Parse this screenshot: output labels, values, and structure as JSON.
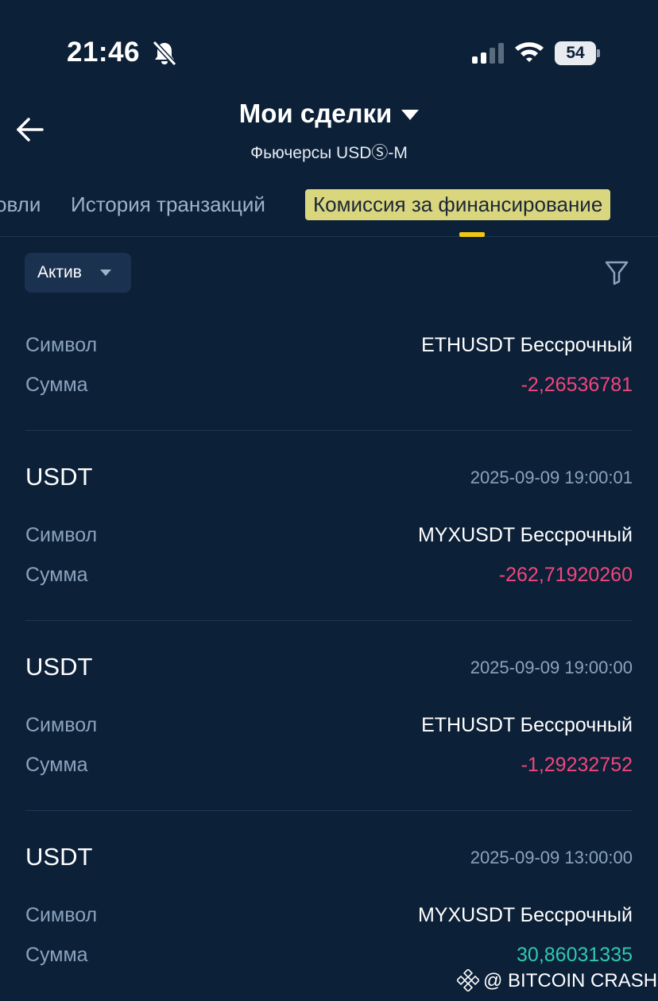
{
  "status_bar": {
    "time": "21:46",
    "battery": "54",
    "icons": [
      "bell-slash-icon",
      "signal-icon",
      "wifi-icon",
      "battery-icon"
    ]
  },
  "header": {
    "title": "Мои сделки",
    "subtitle": "Фьючерсы USDⓈ-M",
    "back_icon": "arrow-left-icon",
    "dropdown_icon": "caret-down-icon"
  },
  "tabs": [
    {
      "label": "овли",
      "active": false
    },
    {
      "label": "История транзакций",
      "active": false
    },
    {
      "label": "Комиссия за финансирование",
      "active": true
    }
  ],
  "filters": {
    "asset_label": "Актив",
    "filter_icon": "funnel-icon"
  },
  "records": [
    {
      "currency": "",
      "timestamp": "",
      "symbol_label": "Символ",
      "symbol": "ETHUSDT Бессрочный",
      "amount_label": "Сумма",
      "amount": "-2,26536781",
      "amount_color": "#f0477b"
    },
    {
      "currency": "USDT",
      "timestamp": "2025-09-09 19:00:01",
      "symbol_label": "Символ",
      "symbol": "MYXUSDT Бессрочный",
      "amount_label": "Сумма",
      "amount": "-262,71920260",
      "amount_color": "#f0477b"
    },
    {
      "currency": "USDT",
      "timestamp": "2025-09-09 19:00:00",
      "symbol_label": "Символ",
      "symbol": "ETHUSDT Бессрочный",
      "amount_label": "Сумма",
      "amount": "-1,29232752",
      "amount_color": "#f0477b"
    },
    {
      "currency": "USDT",
      "timestamp": "2025-09-09 13:00:00",
      "symbol_label": "Символ",
      "symbol": "MYXUSDT Бессрочный",
      "amount_label": "Сумма",
      "amount": "30,86031335",
      "amount_color": "#2fc9ae"
    }
  ],
  "watermark": {
    "text": "@ BITCOIN CRASH",
    "icon": "binance-logo-icon"
  },
  "colors": {
    "background": "#0c2038",
    "accent": "#f0c813",
    "negative": "#f0477b",
    "positive": "#2fc9ae",
    "muted": "#8ba3bd"
  }
}
